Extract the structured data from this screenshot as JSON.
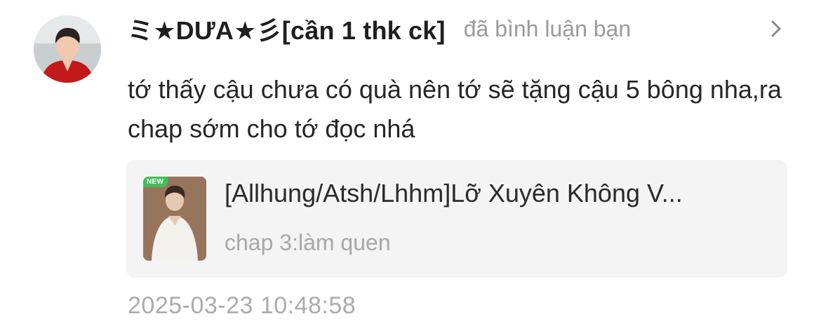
{
  "notification": {
    "avatar_icon": "user-avatar",
    "username": "ミ★DƯA★彡[cần 1 thk ck]",
    "action_text": "đã bình luận bạn",
    "chevron_icon": "chevron-right-icon",
    "comment": "tớ thấy cậu chưa có quà nên tớ sẽ tặng cậu 5 bông nha,ra chap sớm cho tớ đọc nhá",
    "story": {
      "badge": "NEW",
      "title": "[Allhung/Atsh/Lhhm]Lỡ Xuyên Không V...",
      "chapter": "chap 3:làm quen"
    },
    "timestamp": "2025-03-23 10:48:58"
  },
  "colors": {
    "card_background": "#f4f4f4",
    "secondary_text": "#9a9a9a",
    "new_badge": "#3fbf5a"
  }
}
